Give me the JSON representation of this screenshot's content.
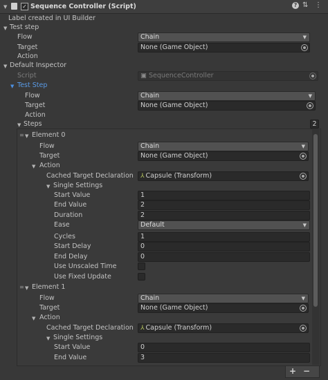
{
  "header": {
    "title": "Sequence Controller (Script)",
    "help_icon": "question-icon",
    "presets_icon": "sliders-icon",
    "menu_icon": "kebab-menu-icon"
  },
  "label_created": "Label created in UI Builder",
  "test_step": {
    "title": "Test step",
    "flow_label": "Flow",
    "flow_value": "Chain",
    "target_label": "Target",
    "target_value": "None (Game Object)",
    "action_label": "Action"
  },
  "default_inspector": {
    "title": "Default Inspector",
    "script_label": "Script",
    "script_value": "SequenceController",
    "test_step_title": "Test Step",
    "flow_label": "Flow",
    "flow_value": "Chain",
    "target_label": "Target",
    "target_value": "None (Game Object)",
    "action_label": "Action",
    "steps_label": "Steps",
    "steps_count": "2"
  },
  "elements": [
    {
      "title": "Element 0",
      "flow_label": "Flow",
      "flow_value": "Chain",
      "target_label": "Target",
      "target_value": "None (Game Object)",
      "action_label": "Action",
      "cached_label": "Cached Target Declaration",
      "cached_value": "Capsule (Transform)",
      "single_settings": "Single Settings",
      "start_value_label": "Start Value",
      "start_value": "1",
      "end_value_label": "End Value",
      "end_value": "2",
      "duration_label": "Duration",
      "duration": "2",
      "ease_label": "Ease",
      "ease": "Default",
      "cycles_label": "Cycles",
      "cycles": "1",
      "start_delay_label": "Start Delay",
      "start_delay": "0",
      "end_delay_label": "End Delay",
      "end_delay": "0",
      "unscaled_label": "Use Unscaled Time",
      "fixed_label": "Use Fixed Update"
    },
    {
      "title": "Element 1",
      "flow_label": "Flow",
      "flow_value": "Chain",
      "target_label": "Target",
      "target_value": "None (Game Object)",
      "action_label": "Action",
      "cached_label": "Cached Target Declaration",
      "cached_value": "Capsule (Transform)",
      "single_settings": "Single Settings",
      "start_value_label": "Start Value",
      "start_value": "0",
      "end_value_label": "End Value",
      "end_value": "3"
    }
  ],
  "list_controls": {
    "add": "+",
    "remove": "−"
  }
}
